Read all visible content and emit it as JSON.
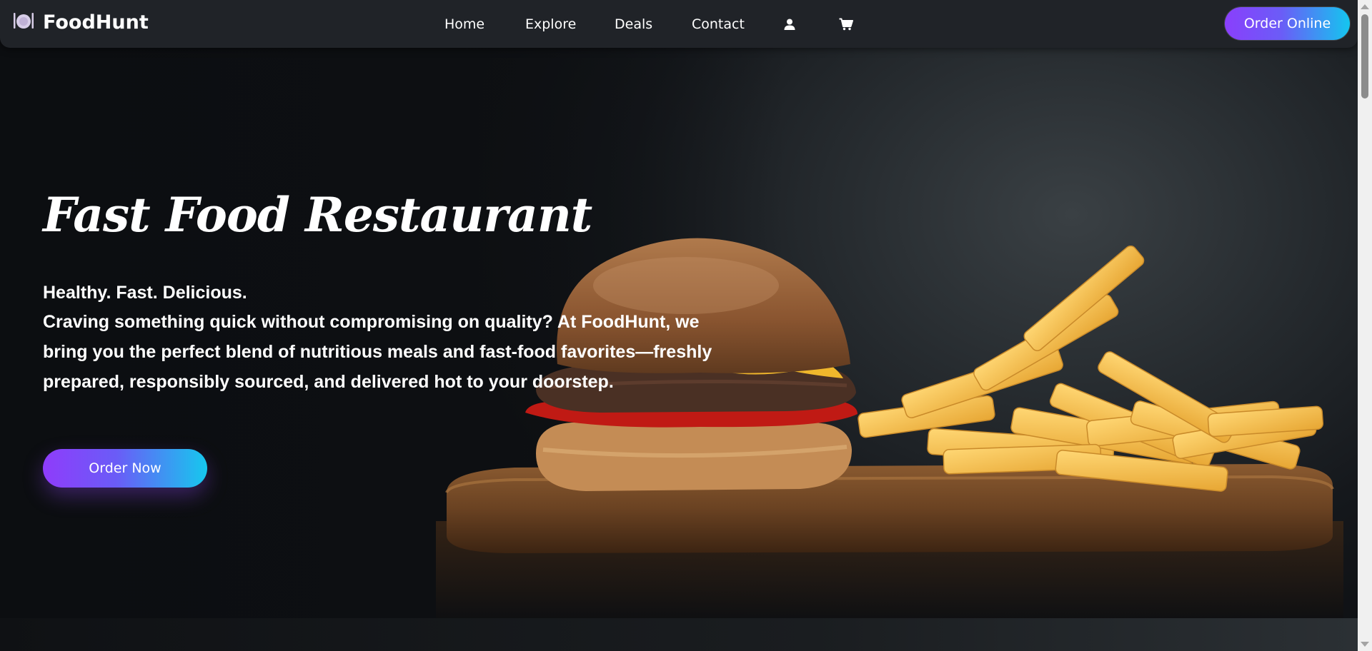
{
  "navbar": {
    "brand": "FoodHunt",
    "brand_icon": "dinner-plate-icon",
    "links": [
      "Home",
      "Explore",
      "Deals",
      "Contact"
    ],
    "user_icon": "user-icon",
    "cart_icon": "cart-icon",
    "cta_label": "Order Online"
  },
  "hero": {
    "title": "Fast Food Restaurant",
    "tagline": "Healthy. Fast. Delicious.",
    "description": "Craving something quick without compromising on quality? At FoodHunt, we bring you the perfect blend of nutritious meals and fast-food favorites—freshly prepared, responsibly sourced, and delivered hot to your doorstep.",
    "cta_label": "Order Now",
    "image": "burger-and-fries-on-wooden-board"
  },
  "colors": {
    "accent_start": "#8a3ffc",
    "accent_end": "#14c6ef",
    "navbar_bg": "#202328",
    "page_bg": "#0e1014"
  }
}
